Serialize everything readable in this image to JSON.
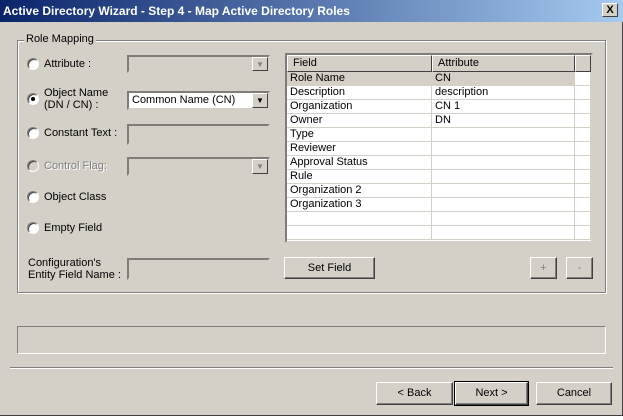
{
  "window": {
    "title": "Active Directory Wizard - Step 4 - Map Active Directory Roles",
    "close": "X"
  },
  "group": {
    "label": "Role Mapping"
  },
  "options": {
    "attribute": "Attribute :",
    "object_name": "Object Name (DN / CN) :",
    "object_name_value": "Common Name (CN)",
    "constant_text": "Constant Text :",
    "control_flag": "Control Flag:",
    "object_class": "Object Class",
    "empty_field": "Empty Field",
    "entity_field": "Configuration's Entity Field Name :"
  },
  "table": {
    "headers": [
      "Field",
      "Attribute"
    ],
    "rows": [
      {
        "field": "Role Name",
        "attribute": "CN"
      },
      {
        "field": "Description",
        "attribute": "description"
      },
      {
        "field": "Organization",
        "attribute": "CN 1"
      },
      {
        "field": "Owner",
        "attribute": "DN"
      },
      {
        "field": "Type",
        "attribute": ""
      },
      {
        "field": "Reviewer",
        "attribute": ""
      },
      {
        "field": "Approval Status",
        "attribute": ""
      },
      {
        "field": "Rule",
        "attribute": ""
      },
      {
        "field": "Organization 2",
        "attribute": ""
      },
      {
        "field": "Organization 3",
        "attribute": ""
      },
      {
        "field": "",
        "attribute": ""
      },
      {
        "field": "",
        "attribute": ""
      }
    ]
  },
  "buttons": {
    "set_field": "Set Field",
    "plus": "+",
    "minus": "-",
    "back": "< Back",
    "next": "Next >",
    "cancel": "Cancel"
  }
}
